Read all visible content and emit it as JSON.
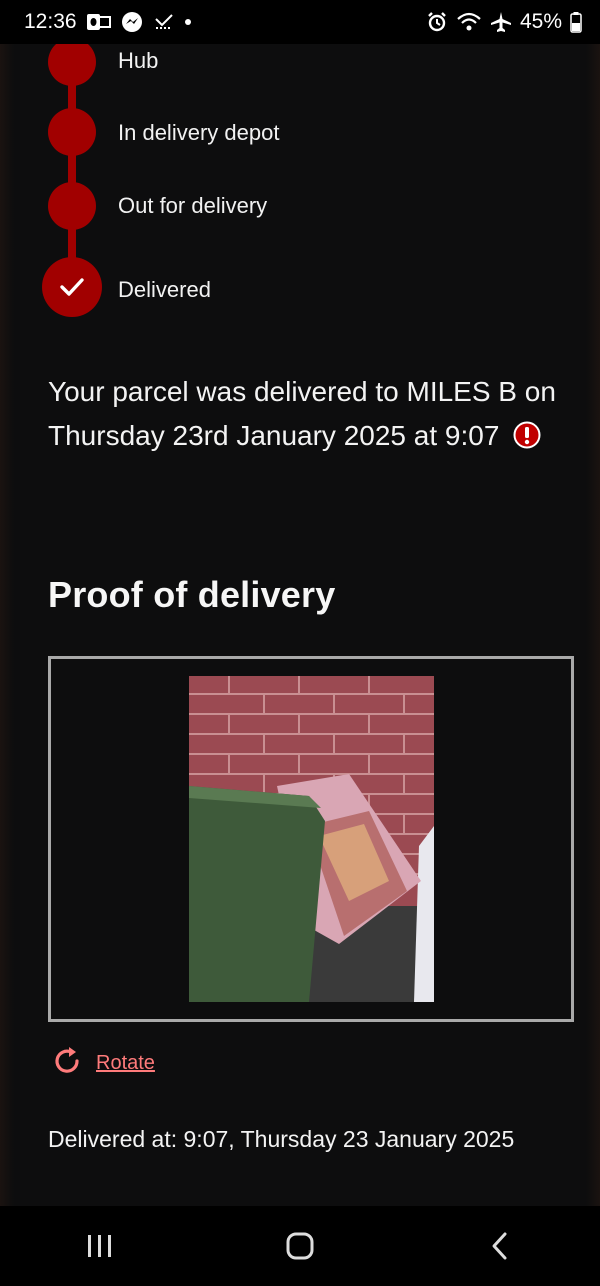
{
  "status_bar": {
    "time": "12:36",
    "battery": "45%",
    "icons": [
      "outlook-icon",
      "messenger-icon",
      "call-missed-icon",
      "notification-dot",
      "alarm-icon",
      "wifi-icon",
      "airplane-icon",
      "battery-icon"
    ]
  },
  "timeline": {
    "steps": [
      {
        "label": "Hub",
        "state": "complete"
      },
      {
        "label": "In delivery depot",
        "state": "complete"
      },
      {
        "label": "Out for delivery",
        "state": "complete"
      },
      {
        "label": "Delivered",
        "state": "current",
        "icon": "check-icon"
      }
    ],
    "accent_color": "#a10000"
  },
  "message": {
    "text": "Your parcel was delivered to MILES B on Thursday 23rd January 2025 at 9:07",
    "icon": "alert-icon"
  },
  "proof": {
    "title": "Proof of delivery",
    "rotate_label": "Rotate",
    "delivered_at": "Delivered at: 9:07, Thursday 23 January 2025"
  },
  "nav_bar": {
    "buttons": [
      "recents-icon",
      "home-icon",
      "back-icon"
    ]
  }
}
